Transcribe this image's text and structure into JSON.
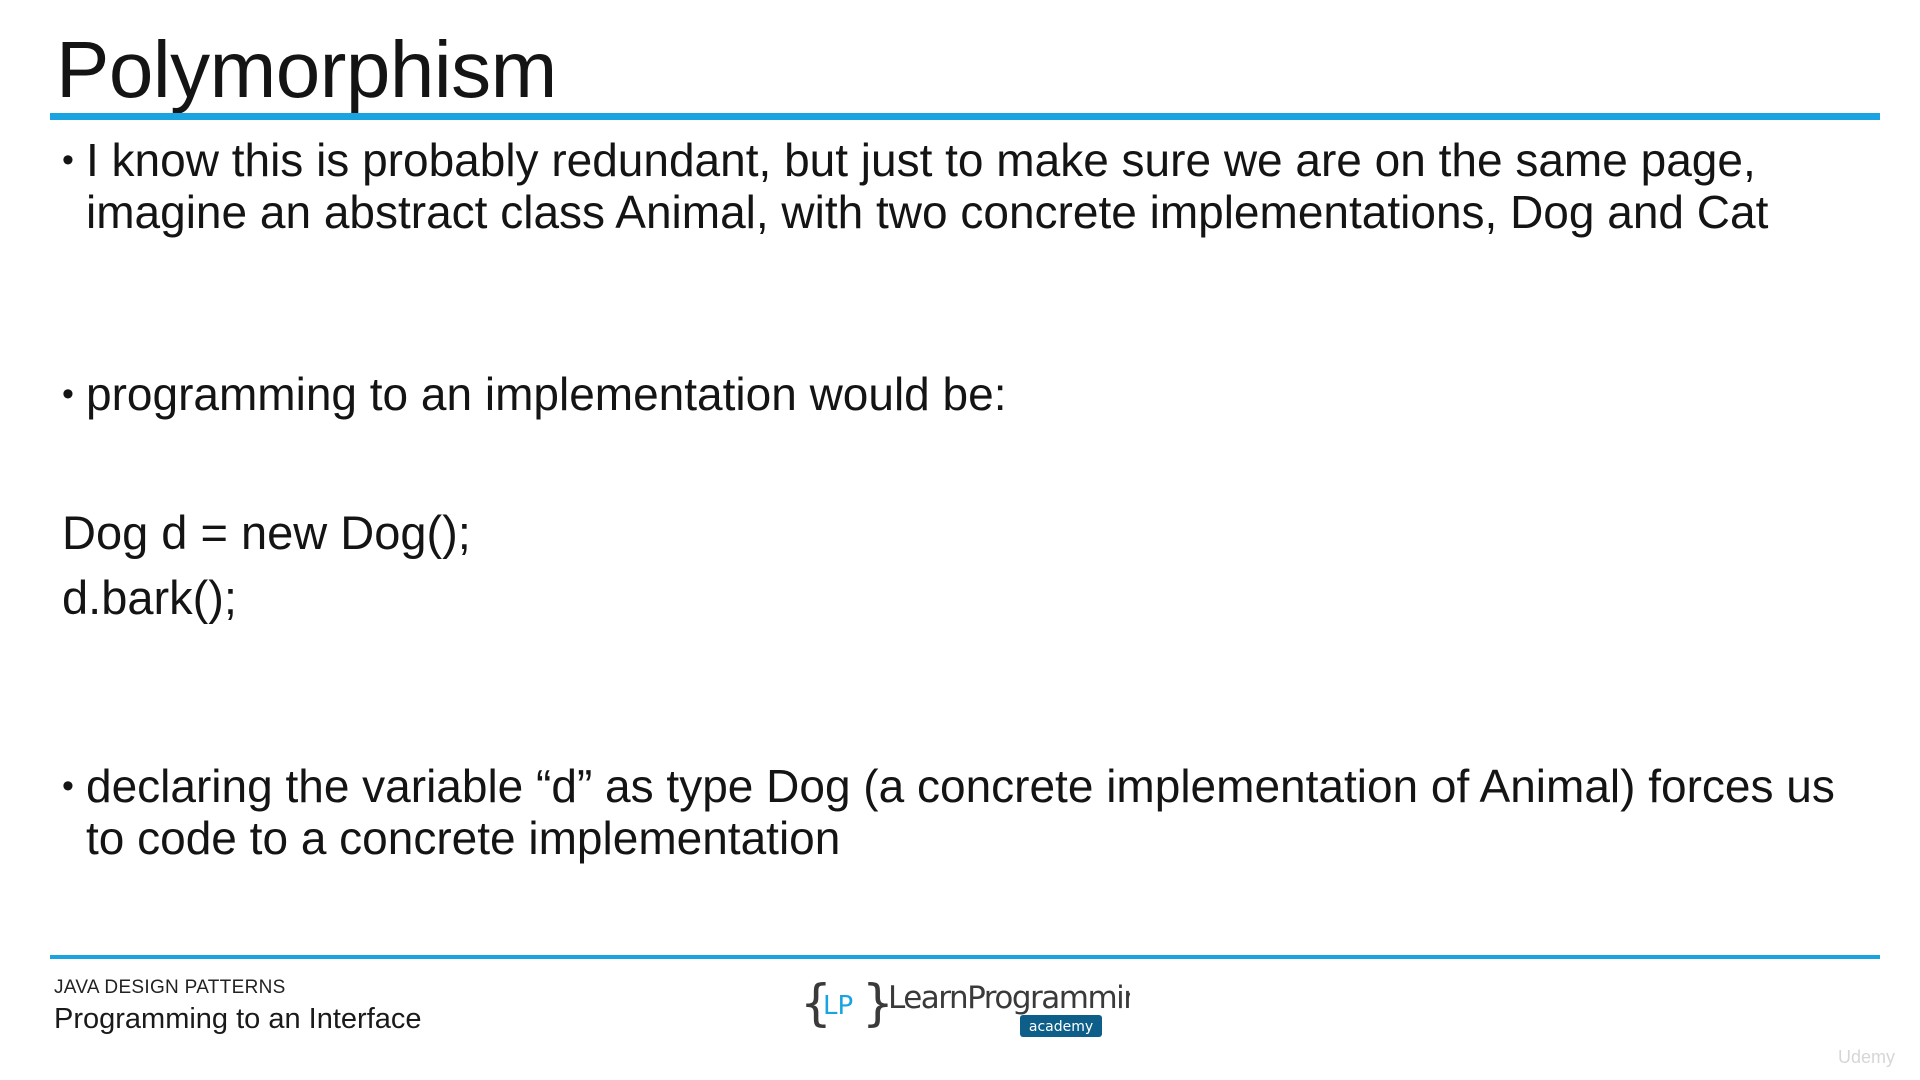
{
  "slide": {
    "title": "Polymorphism",
    "bullets": [
      "I know this is probably redundant, but just to make sure we are on the same page, imagine an abstract class Animal, with two concrete implementations, Dog and Cat",
      "programming to an implementation would be:",
      "declaring the variable “d” as type Dog (a concrete implementation of Animal) forces us to code to a concrete implementation"
    ],
    "code_lines": [
      "Dog d = new Dog();",
      "d.bark();"
    ],
    "bullet_symbol": "•"
  },
  "footer": {
    "course": "JAVA DESIGN PATTERNS",
    "lesson": "Programming to an Interface",
    "logo": {
      "brand": "LearnProgramming",
      "sub": "academy",
      "mark": "LP"
    },
    "watermark": "Udemy"
  },
  "colors": {
    "accent": "#1aa3e1",
    "text": "#141414",
    "logo_dark": "#3a3a3a",
    "logo_blue": "#1aa3e1",
    "logo_badge": "#0d5f8a"
  }
}
